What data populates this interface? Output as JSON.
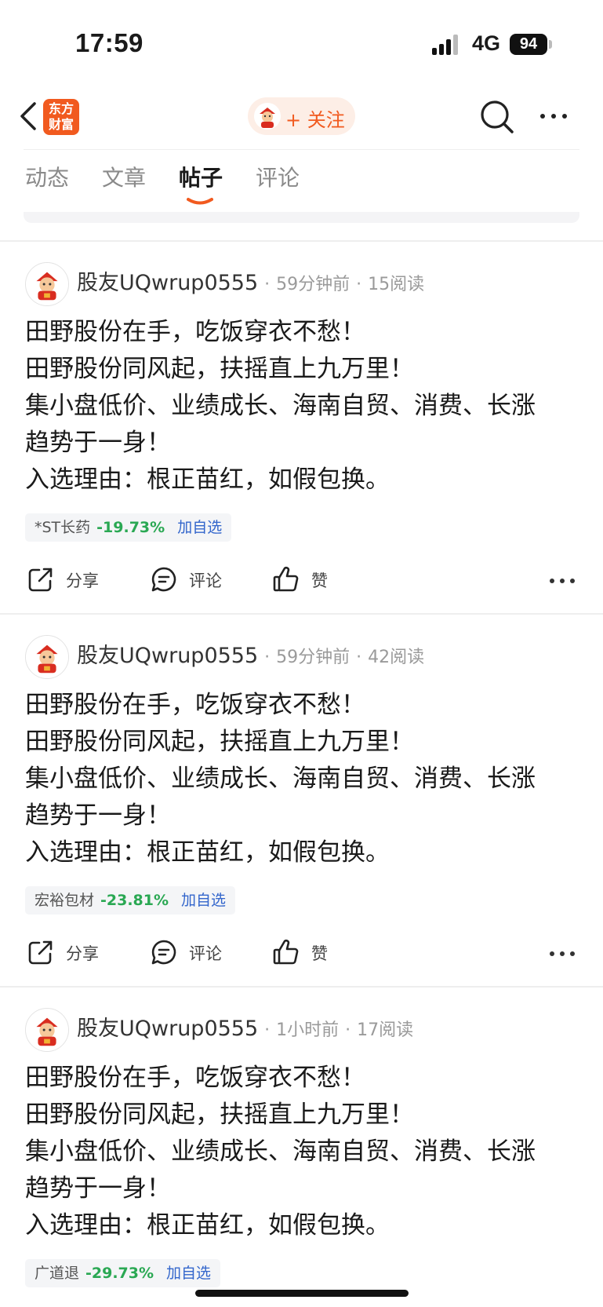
{
  "status_bar": {
    "time": "17:59",
    "network": "4G",
    "battery": "94"
  },
  "nav": {
    "brand_logo_text": "东方财富",
    "follow_label": "+ 关注",
    "accent_color": "#f15a1f"
  },
  "tabs": [
    {
      "label": "动态",
      "active": false
    },
    {
      "label": "文章",
      "active": false
    },
    {
      "label": "帖子",
      "active": true
    },
    {
      "label": "评论",
      "active": false
    }
  ],
  "posts": [
    {
      "author": "股友UQwrup0555",
      "time": "59分钟前",
      "reads": "15阅读",
      "lines": [
        "田野股份在手，吃饭穿衣不愁！",
        "田野股份同风起，扶摇直上九万里！",
        "集小盘低价、业绩成长、海南自贸、消费、长涨",
        "趋势于一身！",
        "入选理由：根正苗红，如假包换。"
      ],
      "stock": {
        "name": "*ST长药",
        "change": "-19.73%",
        "add_label": "加自选"
      },
      "actions": {
        "share": "分享",
        "comment": "评论",
        "like": "赞"
      }
    },
    {
      "author": "股友UQwrup0555",
      "time": "59分钟前",
      "reads": "42阅读",
      "lines": [
        "田野股份在手，吃饭穿衣不愁！",
        "田野股份同风起，扶摇直上九万里！",
        "集小盘低价、业绩成长、海南自贸、消费、长涨",
        "趋势于一身！",
        "入选理由：根正苗红，如假包换。"
      ],
      "stock": {
        "name": "宏裕包材",
        "change": "-23.81%",
        "add_label": "加自选"
      },
      "actions": {
        "share": "分享",
        "comment": "评论",
        "like": "赞"
      }
    },
    {
      "author": "股友UQwrup0555",
      "time": "1小时前",
      "reads": "17阅读",
      "lines": [
        "田野股份在手，吃饭穿衣不愁！",
        "田野股份同风起，扶摇直上九万里！",
        "集小盘低价、业绩成长、海南自贸、消费、长涨",
        "趋势于一身！",
        "入选理由：根正苗红，如假包换。"
      ],
      "stock": {
        "name": "广道退",
        "change": "-29.73%",
        "add_label": "加自选"
      },
      "actions": {
        "share": "分享",
        "comment": "评论",
        "like": "赞"
      }
    }
  ],
  "colors": {
    "down": "#2aa853",
    "link": "#3366cc"
  }
}
